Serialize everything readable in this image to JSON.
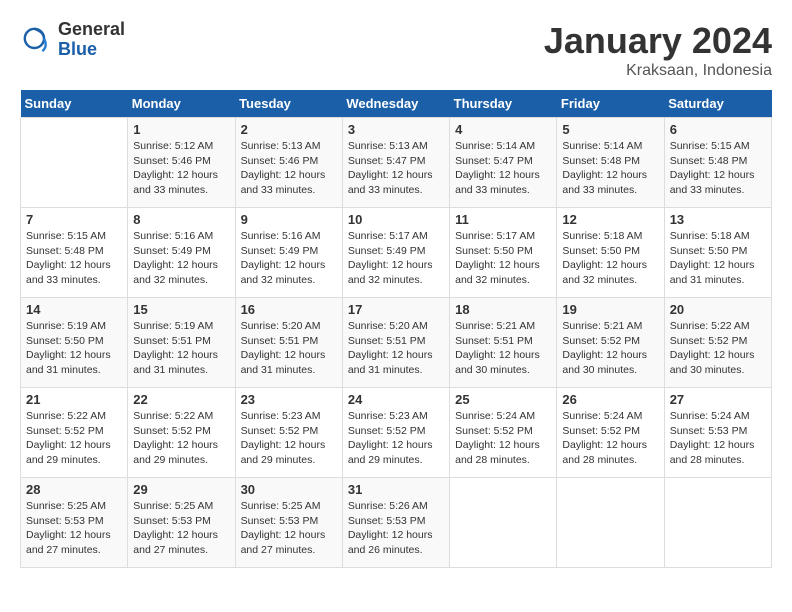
{
  "header": {
    "logo_general": "General",
    "logo_blue": "Blue",
    "month_title": "January 2024",
    "subtitle": "Kraksaan, Indonesia"
  },
  "days_of_week": [
    "Sunday",
    "Monday",
    "Tuesday",
    "Wednesday",
    "Thursday",
    "Friday",
    "Saturday"
  ],
  "weeks": [
    [
      {
        "day": "",
        "info": ""
      },
      {
        "day": "1",
        "info": "Sunrise: 5:12 AM\nSunset: 5:46 PM\nDaylight: 12 hours\nand 33 minutes."
      },
      {
        "day": "2",
        "info": "Sunrise: 5:13 AM\nSunset: 5:46 PM\nDaylight: 12 hours\nand 33 minutes."
      },
      {
        "day": "3",
        "info": "Sunrise: 5:13 AM\nSunset: 5:47 PM\nDaylight: 12 hours\nand 33 minutes."
      },
      {
        "day": "4",
        "info": "Sunrise: 5:14 AM\nSunset: 5:47 PM\nDaylight: 12 hours\nand 33 minutes."
      },
      {
        "day": "5",
        "info": "Sunrise: 5:14 AM\nSunset: 5:48 PM\nDaylight: 12 hours\nand 33 minutes."
      },
      {
        "day": "6",
        "info": "Sunrise: 5:15 AM\nSunset: 5:48 PM\nDaylight: 12 hours\nand 33 minutes."
      }
    ],
    [
      {
        "day": "7",
        "info": "Sunrise: 5:15 AM\nSunset: 5:48 PM\nDaylight: 12 hours\nand 33 minutes."
      },
      {
        "day": "8",
        "info": "Sunrise: 5:16 AM\nSunset: 5:49 PM\nDaylight: 12 hours\nand 32 minutes."
      },
      {
        "day": "9",
        "info": "Sunrise: 5:16 AM\nSunset: 5:49 PM\nDaylight: 12 hours\nand 32 minutes."
      },
      {
        "day": "10",
        "info": "Sunrise: 5:17 AM\nSunset: 5:49 PM\nDaylight: 12 hours\nand 32 minutes."
      },
      {
        "day": "11",
        "info": "Sunrise: 5:17 AM\nSunset: 5:50 PM\nDaylight: 12 hours\nand 32 minutes."
      },
      {
        "day": "12",
        "info": "Sunrise: 5:18 AM\nSunset: 5:50 PM\nDaylight: 12 hours\nand 32 minutes."
      },
      {
        "day": "13",
        "info": "Sunrise: 5:18 AM\nSunset: 5:50 PM\nDaylight: 12 hours\nand 31 minutes."
      }
    ],
    [
      {
        "day": "14",
        "info": "Sunrise: 5:19 AM\nSunset: 5:50 PM\nDaylight: 12 hours\nand 31 minutes."
      },
      {
        "day": "15",
        "info": "Sunrise: 5:19 AM\nSunset: 5:51 PM\nDaylight: 12 hours\nand 31 minutes."
      },
      {
        "day": "16",
        "info": "Sunrise: 5:20 AM\nSunset: 5:51 PM\nDaylight: 12 hours\nand 31 minutes."
      },
      {
        "day": "17",
        "info": "Sunrise: 5:20 AM\nSunset: 5:51 PM\nDaylight: 12 hours\nand 31 minutes."
      },
      {
        "day": "18",
        "info": "Sunrise: 5:21 AM\nSunset: 5:51 PM\nDaylight: 12 hours\nand 30 minutes."
      },
      {
        "day": "19",
        "info": "Sunrise: 5:21 AM\nSunset: 5:52 PM\nDaylight: 12 hours\nand 30 minutes."
      },
      {
        "day": "20",
        "info": "Sunrise: 5:22 AM\nSunset: 5:52 PM\nDaylight: 12 hours\nand 30 minutes."
      }
    ],
    [
      {
        "day": "21",
        "info": "Sunrise: 5:22 AM\nSunset: 5:52 PM\nDaylight: 12 hours\nand 29 minutes."
      },
      {
        "day": "22",
        "info": "Sunrise: 5:22 AM\nSunset: 5:52 PM\nDaylight: 12 hours\nand 29 minutes."
      },
      {
        "day": "23",
        "info": "Sunrise: 5:23 AM\nSunset: 5:52 PM\nDaylight: 12 hours\nand 29 minutes."
      },
      {
        "day": "24",
        "info": "Sunrise: 5:23 AM\nSunset: 5:52 PM\nDaylight: 12 hours\nand 29 minutes."
      },
      {
        "day": "25",
        "info": "Sunrise: 5:24 AM\nSunset: 5:52 PM\nDaylight: 12 hours\nand 28 minutes."
      },
      {
        "day": "26",
        "info": "Sunrise: 5:24 AM\nSunset: 5:52 PM\nDaylight: 12 hours\nand 28 minutes."
      },
      {
        "day": "27",
        "info": "Sunrise: 5:24 AM\nSunset: 5:53 PM\nDaylight: 12 hours\nand 28 minutes."
      }
    ],
    [
      {
        "day": "28",
        "info": "Sunrise: 5:25 AM\nSunset: 5:53 PM\nDaylight: 12 hours\nand 27 minutes."
      },
      {
        "day": "29",
        "info": "Sunrise: 5:25 AM\nSunset: 5:53 PM\nDaylight: 12 hours\nand 27 minutes."
      },
      {
        "day": "30",
        "info": "Sunrise: 5:25 AM\nSunset: 5:53 PM\nDaylight: 12 hours\nand 27 minutes."
      },
      {
        "day": "31",
        "info": "Sunrise: 5:26 AM\nSunset: 5:53 PM\nDaylight: 12 hours\nand 26 minutes."
      },
      {
        "day": "",
        "info": ""
      },
      {
        "day": "",
        "info": ""
      },
      {
        "day": "",
        "info": ""
      }
    ]
  ]
}
